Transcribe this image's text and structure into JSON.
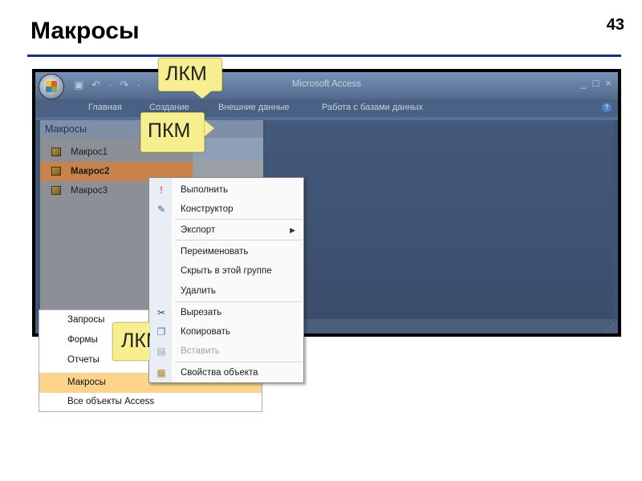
{
  "slide": {
    "title": "Макросы",
    "number": "43"
  },
  "window": {
    "title": "Microsoft Access",
    "controls": [
      "_",
      "□",
      "×"
    ],
    "qat": [
      "▣",
      "↶",
      "·",
      "↷",
      "·"
    ]
  },
  "ribbon": {
    "tabs": [
      "Главная",
      "Создание",
      "Внешние данные",
      "Работа с базами данных"
    ],
    "help": "?"
  },
  "nav_pane": {
    "header": "Макросы",
    "items": [
      {
        "label": "Макрос1",
        "selected": false
      },
      {
        "label": "Макрос2",
        "selected": true
      },
      {
        "label": "Макрос3",
        "selected": false
      }
    ]
  },
  "category_menu": {
    "items": [
      {
        "label": "Запросы",
        "selected": false
      },
      {
        "label": "Формы",
        "selected": false
      },
      {
        "label": "Отчеты",
        "selected": false
      },
      {
        "label": "Макросы",
        "selected": true
      },
      {
        "label": "Все объекты Access",
        "selected": false
      }
    ]
  },
  "context_menu": {
    "items": [
      {
        "label": "Выполнить",
        "icon": "run-icon",
        "enabled": true
      },
      {
        "label": "Конструктор",
        "icon": "design-icon",
        "enabled": true
      },
      {
        "label": "Экспорт",
        "icon": "",
        "enabled": true,
        "submenu": true
      },
      {
        "label": "Переименовать",
        "icon": "",
        "enabled": true
      },
      {
        "label": "Скрыть в этой группе",
        "icon": "",
        "enabled": true
      },
      {
        "label": "Удалить",
        "icon": "",
        "enabled": true
      },
      {
        "label": "Вырезать",
        "icon": "scissors-icon",
        "enabled": true
      },
      {
        "label": "Копировать",
        "icon": "copy-icon",
        "enabled": true
      },
      {
        "label": "Вставить",
        "icon": "paste-icon",
        "enabled": false
      },
      {
        "label": "Свойства объекта",
        "icon": "properties-icon",
        "enabled": true
      }
    ]
  },
  "callouts": {
    "top": "ЛКМ",
    "middle": "ПКМ",
    "bottom": "ЛКМ"
  },
  "colors": {
    "title_rule": "#1c2f8c",
    "selected_macro": "#c7834a",
    "selected_category": "#fbd38b",
    "callout": "#f7ee8f"
  }
}
